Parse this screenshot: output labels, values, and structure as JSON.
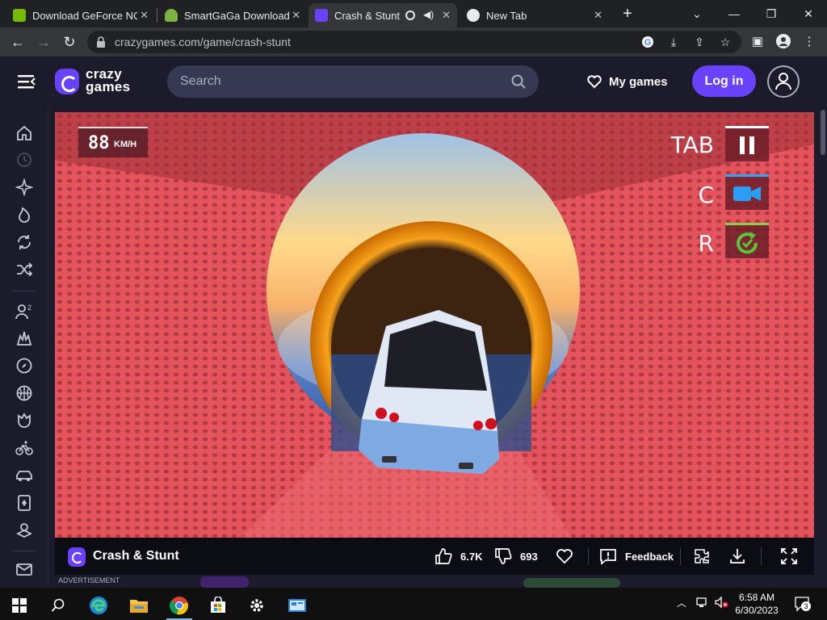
{
  "browser": {
    "tabs": [
      {
        "title": "Download GeForce NO",
        "favicon_color": "#76b900"
      },
      {
        "title": "SmartGaGa Download",
        "favicon_color": "#7cb342"
      },
      {
        "title": "Crash & Stunt",
        "favicon_color": "#6842ff",
        "active": true
      },
      {
        "title": "New Tab",
        "favicon_color": "#ffffff"
      }
    ],
    "url": "crazygames.com/game/crash-stunt"
  },
  "site": {
    "logo_line1": "crazy",
    "logo_line2": "games",
    "search_placeholder": "Search",
    "my_games_label": "My games",
    "login_label": "Log in",
    "accent": "#6842ff"
  },
  "sidebar": {
    "items": [
      "home-icon",
      "recent-icon",
      "new-icon",
      "trending-icon",
      "updated-icon",
      "random-icon",
      "multiplayer-icon",
      "action-icon",
      "adventure-icon",
      "basketball-icon",
      "casual-icon",
      "bike-icon",
      "car-icon",
      "card-icon",
      "clicker-icon",
      "mail-icon"
    ]
  },
  "game": {
    "speed_value": "88",
    "speed_unit": "KM/H",
    "hud": [
      {
        "key": "TAB",
        "action": "pause-icon"
      },
      {
        "key": "C",
        "action": "camera-icon"
      },
      {
        "key": "R",
        "action": "reset-icon"
      }
    ]
  },
  "game_bar": {
    "title": "Crash & Stunt",
    "likes": "6.7K",
    "dislikes": "693",
    "feedback_label": "Feedback"
  },
  "ad_label": "ADVERTISEMENT",
  "taskbar": {
    "time": "6:58 AM",
    "date": "6/30/2023",
    "notifications": "3"
  }
}
